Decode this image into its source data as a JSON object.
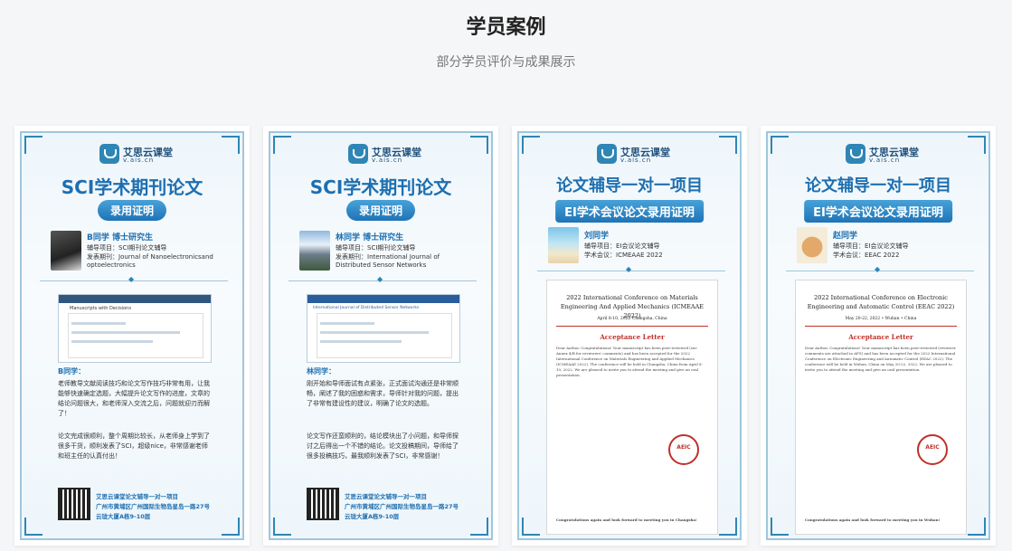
{
  "section": {
    "title": "学员案例",
    "subtitle": "部分学员评价与成果展示"
  },
  "brand": {
    "name": "艾思云课堂",
    "url": "v.ais.cn"
  },
  "cards": [
    {
      "heading": "SCI学术期刊论文",
      "badge": "录用证明",
      "student": "B同学  博士研究生",
      "line1": "辅导项目：SCI期刊论文辅导",
      "line2": "发表期刊：Journal of Nanoelectronicsand",
      "line3": "optoelectronics",
      "shot_title": "Manuscripts with Decisions",
      "feedback_title": "B同学：",
      "feedback_1": "老师教导文献阅读技巧和论文写作技巧非常有用，让我能够快速确定选题，大幅提升论文写作的进度，文章的结论问题很大，和老师深入交流之后，问题就迎刃而解了！",
      "feedback_2": "论文完成很顺利，整个周期比较长，从老师身上学到了很多干货，顺利发表了SCI，超级nice，非常感谢老师和班主任的认真付出！",
      "addr1": "艾思云课堂论文辅导一对一项目",
      "addr2": "广州市黄埔区广州国际生物岛星岛一路27号",
      "addr3": "云珑大厦A栋9-10层"
    },
    {
      "heading": "SCI学术期刊论文",
      "badge": "录用证明",
      "student": "林同学  博士研究生",
      "line1": "辅导项目：SCI期刊论文辅导",
      "line2": "发表期刊：International Journal of",
      "line3": "Distributed Sensor Networks",
      "shot_title": "International Journal of Distributed Sensor Networks",
      "feedback_title": "林同学：",
      "feedback_1": "刚开始和导师面试有点紧张，正式面试沟通还是非常顺畅，阐述了我的困惑和需求，导师针对我的问题，提出了非常有建设性的建议，明确了论文的选题。",
      "feedback_2": "论文写作还蛮顺利的，结论模块出了小问题，和导师探讨之后得出一个不错的结论。论文投稿期间，导师给了很多投稿技巧，最我顺利发表了SCI，非常感谢！",
      "addr1": "艾思云课堂论文辅导一对一项目",
      "addr2": "广州市黄埔区广州国际生物岛星岛一路27号",
      "addr3": "云珑大厦A栋9-10层"
    },
    {
      "heading": "论文辅导一对一项目",
      "badge": "EI学术会议论文录用证明",
      "student": "刘同学",
      "line1": "辅导项目：EI会议论文辅导",
      "line2": "学术会议：ICMEAAE 2022",
      "letter_title": "2022 International Conference on Materials Engineering And Applied Mechanics (ICMEAAE 2022)",
      "letter_date": "April 8-10, 2022 Changsha, China",
      "acceptance": "Acceptance Letter",
      "body": "Dear Author, Congratulations! Your manuscript has been peer-reviewed (see Annex 4/B for reviewers' comments) and has been accepted for the 2022 International Conference on Materials Engineering and Applied Mechanics (ICMEAAE 2022). The conference will be held in Changsha, China from April 8-10, 2022. We are pleased to invite you to attend the meeting and give an oral presentation.",
      "closing": "Congratulations again and look forward to meeting you in Changsha!",
      "stamp": "AEIC"
    },
    {
      "heading": "论文辅导一对一项目",
      "badge": "EI学术会议论文录用证明",
      "student": "赵同学",
      "line1": "辅导项目：EI会议论文辅导",
      "line2": "学术会议：EEAC 2022",
      "letter_title": "2022 International Conference on Electronic Engineering and Automatic Control (EEAC 2022)",
      "letter_date": "May 20-22, 2022 • Wuhan • China",
      "acceptance": "Acceptance Letter",
      "body": "Dear Author, Congratulations! Your manuscript has been peer-reviewed (reviewer comments are attached in AFS) and has been accepted for the 2022 International Conference on Electronic Engineering and Automatic Control (EEAC 2022). The conference will be held in Wuhan, China on May 20-22, 2022. We are pleased to invite you to attend the meeting and give an oral presentation.",
      "closing": "Congratulations again and look forward to meeting you in Wuhan!",
      "stamp": "AEIC"
    }
  ]
}
